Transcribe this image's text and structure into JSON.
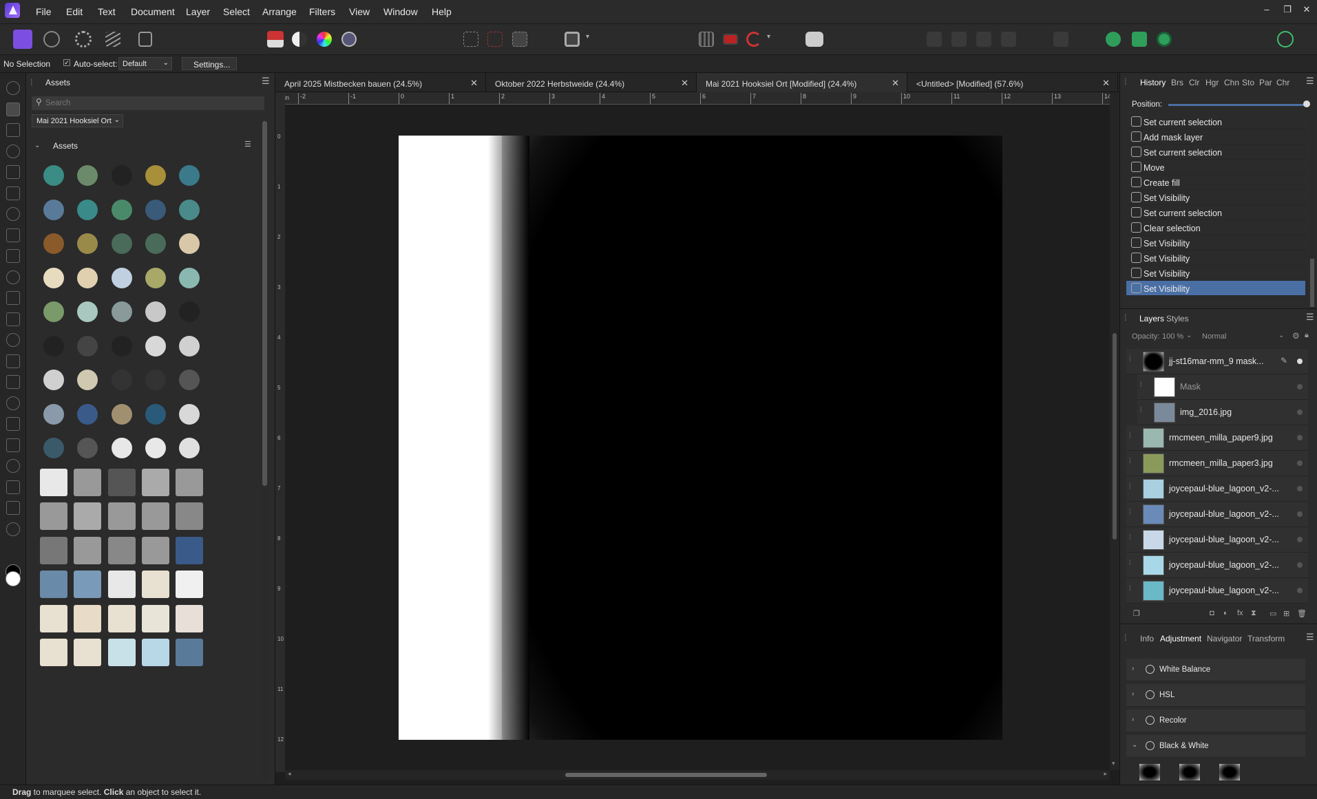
{
  "menu": {
    "items": [
      "File",
      "Edit",
      "Text",
      "Document",
      "Layer",
      "Select",
      "Arrange",
      "Filters",
      "View",
      "Window",
      "Help"
    ],
    "window_controls": [
      "–",
      "❐",
      "✕"
    ]
  },
  "context": {
    "selection": "No Selection",
    "autoselect_label": "Auto-select:",
    "autoselect_value": "Default",
    "settings_label": "Settings..."
  },
  "assets": {
    "panel_title": "Assets",
    "search_placeholder": "Search",
    "collection": "Mai 2021 Hooksiel Ort",
    "section": "Assets"
  },
  "tabs": [
    {
      "label": "April 2025 Mistbecken bauen (24.5%)"
    },
    {
      "label": "Oktober 2022 Herbstweide (24.4%)"
    },
    {
      "label": "Mai 2021 Hooksiel Ort [Modified] (24.4%)"
    },
    {
      "label": "<Untitled> [Modified] (57.6%)"
    }
  ],
  "ruler": {
    "unit": "in",
    "ticks": [
      "-2",
      "-1",
      "0",
      "1",
      "2",
      "3",
      "4",
      "5",
      "6",
      "7",
      "8",
      "9",
      "10",
      "11",
      "12",
      "13",
      "14"
    ],
    "vticks": [
      "0",
      "1",
      "2",
      "3",
      "4",
      "5",
      "6",
      "7",
      "8",
      "9",
      "10",
      "11",
      "12"
    ]
  },
  "history": {
    "tabs": [
      "History",
      "Brs",
      "Clr",
      "Hgr",
      "Chn",
      "Sto",
      "Par",
      "Chr"
    ],
    "position_label": "Position:",
    "position_value": 1.0,
    "items": [
      "Set current selection",
      "Add mask layer",
      "Set current selection",
      "Move",
      "Create fill",
      "Set Visibility",
      "Set current selection",
      "Clear selection",
      "Set Visibility",
      "Set Visibility",
      "Set Visibility",
      "Set Visibility"
    ]
  },
  "layers": {
    "tabs": [
      "Layers",
      "Styles"
    ],
    "opacity_label": "Opacity:",
    "opacity_value": "100 %",
    "blend_mode": "Normal",
    "items": [
      {
        "name": "jj-st16mar-mm_9 mask..."
      },
      {
        "name": "Mask"
      },
      {
        "name": "img_2016.jpg"
      },
      {
        "name": "rmcmeen_milla_paper9.jpg"
      },
      {
        "name": "rmcmeen_milla_paper3.jpg"
      },
      {
        "name": "joycepaul-blue_lagoon_v2-..."
      },
      {
        "name": "joycepaul-blue_lagoon_v2-..."
      },
      {
        "name": "joycepaul-blue_lagoon_v2-..."
      },
      {
        "name": "joycepaul-blue_lagoon_v2-..."
      },
      {
        "name": "joycepaul-blue_lagoon_v2-..."
      }
    ]
  },
  "adjust": {
    "tabs": [
      "Info",
      "Adjustment",
      "Navigator",
      "Transform"
    ],
    "items": [
      "White Balance",
      "HSL",
      "Recolor",
      "Black & White"
    ]
  },
  "status": {
    "drag": "Drag",
    "drag_desc": " to marquee select. ",
    "click": "Click",
    "click_desc": " an object to select it."
  },
  "colors": {
    "accent": "#4a6fa5",
    "brand": "#7b4fe0"
  }
}
